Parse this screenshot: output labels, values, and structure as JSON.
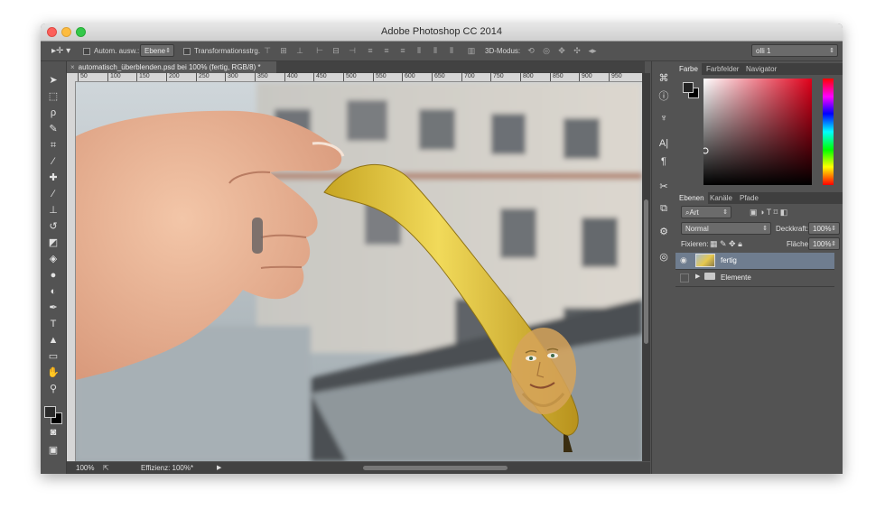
{
  "window": {
    "title": "Adobe Photoshop CC 2014"
  },
  "options_bar": {
    "auto_select_label": "Autom. ausw.:",
    "auto_select_value": "Ebene",
    "transform_label": "Transformationsstrg.",
    "mode_3d_label": "3D-Modus:",
    "workspace_value": "olli 1"
  },
  "document": {
    "tab_title": "automatisch_überblenden.psd bei 100% (fertig, RGB/8) *",
    "ruler_labels": [
      "50",
      "100",
      "150",
      "200",
      "250",
      "300",
      "350",
      "400",
      "450",
      "500",
      "550",
      "600",
      "650",
      "700",
      "750",
      "800",
      "850",
      "900",
      "950"
    ]
  },
  "status": {
    "zoom": "100%",
    "efficiency": "Effizienz: 100%*"
  },
  "color_panel": {
    "tabs": [
      "Farbe",
      "Farbfelder",
      "Navigator"
    ],
    "active": "Farbe"
  },
  "layers_panel": {
    "tabs": [
      "Ebenen",
      "Kanäle",
      "Pfade"
    ],
    "filter_value": "Art",
    "blend_mode": "Normal",
    "opacity_label": "Deckkraft:",
    "opacity_value": "100%",
    "lock_label": "Fixieren:",
    "fill_label": "Fläche:",
    "fill_value": "100%",
    "layers": [
      {
        "name": "fertig",
        "selected": true
      },
      {
        "name": "Elemente",
        "selected": false
      }
    ]
  }
}
